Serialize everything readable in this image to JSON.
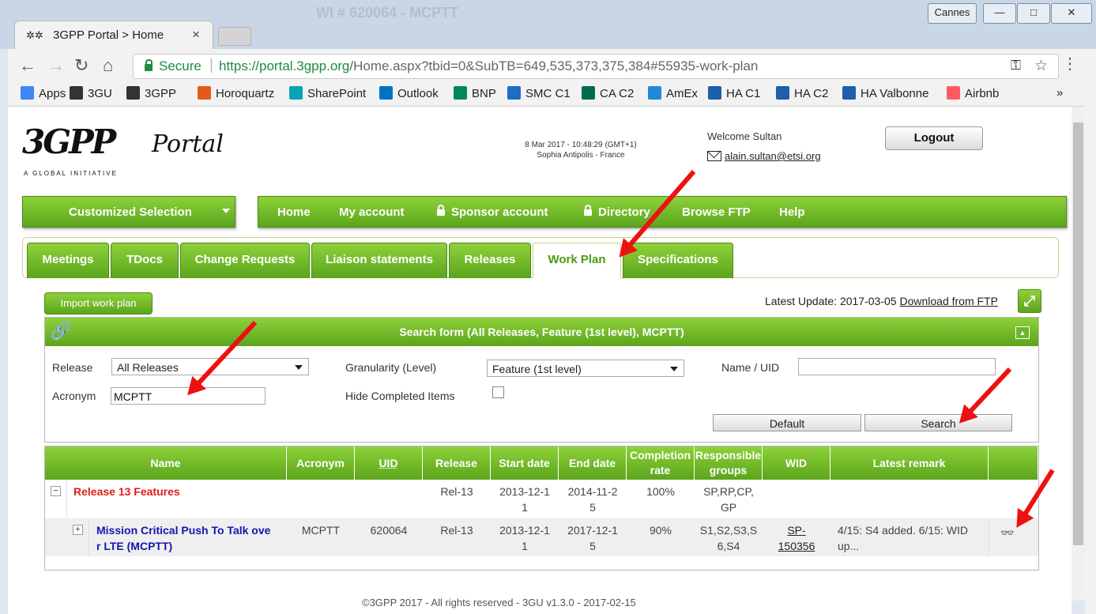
{
  "window": {
    "background_title": "WI # 620064 - MCPTT",
    "cannes_label": "Cannes",
    "minimize": "—",
    "maximize": "□",
    "close": "✕"
  },
  "tab": {
    "title": "3GPP Portal > Home",
    "close": "×"
  },
  "toolbar": {
    "secure_label": "Secure",
    "url_host": "https://portal.3gpp.org",
    "url_path": "/Home.aspx?tbid=0&SubTB=649,535,373,375,384#55935-work-plan"
  },
  "bookmarks": [
    {
      "label": "Apps",
      "icon": "apps-icon",
      "color": "#4285f4"
    },
    {
      "label": "3GU",
      "icon": "3gpp-icon",
      "color": "#333333"
    },
    {
      "label": "3GPP",
      "icon": "3gpp-icon",
      "color": "#333333"
    },
    {
      "label": "Horoquartz",
      "icon": "horoquartz-icon",
      "color": "#e25b1d"
    },
    {
      "label": "SharePoint",
      "icon": "sharepoint-icon",
      "color": "#0aa2b5"
    },
    {
      "label": "Outlook",
      "icon": "outlook-icon",
      "color": "#0072c6"
    },
    {
      "label": "BNP",
      "icon": "bnp-icon",
      "color": "#008856"
    },
    {
      "label": "SMC C1",
      "icon": "star-icon",
      "color": "#1b6ec2"
    },
    {
      "label": "CA C2",
      "icon": "ca-icon",
      "color": "#006a4e"
    },
    {
      "label": "AmEx",
      "icon": "amex-icon",
      "color": "#1e8ad6"
    },
    {
      "label": "HA C1",
      "icon": "ha-icon",
      "color": "#1d5fa8"
    },
    {
      "label": "HA C2",
      "icon": "ha-icon",
      "color": "#1d5fa8"
    },
    {
      "label": "HA Valbonne",
      "icon": "ha-icon",
      "color": "#1d5fa8"
    },
    {
      "label": "Airbnb",
      "icon": "airbnb-icon",
      "color": "#ff5a5f"
    }
  ],
  "header": {
    "logo_text": "3GPP",
    "logo_tagline": "A GLOBAL INITIATIVE",
    "portal_logo": "Portal",
    "datetime_line1": "8 Mar 2017 - 10:48:29 (GMT+1)",
    "datetime_line2": "Sophia Antipolis - France",
    "welcome": "Welcome Sultan",
    "email": "alain.sultan@etsi.org",
    "logout": "Logout"
  },
  "menu": {
    "customized_selection": "Customized Selection",
    "items": [
      "Home",
      "My account",
      "Sponsor account",
      "Directory",
      "Browse FTP",
      "Help"
    ]
  },
  "tabs": [
    "Meetings",
    "TDocs",
    "Change Requests",
    "Liaison statements",
    "Releases",
    "Work Plan",
    "Specifications"
  ],
  "active_tab": "Work Plan",
  "workplan": {
    "import_button": "Import work plan",
    "latest_update_prefix": "Latest Update: 2017-03-05",
    "download_link": "Download from FTP"
  },
  "search_form": {
    "title": "Search form (All Releases, Feature (1st level), MCPTT)",
    "release_label": "Release",
    "release_value": "All Releases",
    "granularity_label": "Granularity (Level)",
    "granularity_value": "Feature (1st level)",
    "name_uid_label": "Name / UID",
    "name_uid_value": "",
    "acronym_label": "Acronym",
    "acronym_value": "MCPTT",
    "hide_completed_label": "Hide Completed Items",
    "default_button": "Default",
    "search_button": "Search"
  },
  "results": {
    "columns": [
      "Name",
      "Acronym",
      "UID",
      "Release",
      "Start date",
      "End date",
      "Completion rate",
      "Responsible groups",
      "WID",
      "Latest remark",
      ""
    ],
    "release_row": {
      "toggle": "−",
      "name": "Release 13 Features",
      "release": "Rel-13",
      "start_date": [
        "2013-12-1",
        "1"
      ],
      "end_date": [
        "2014-11-2",
        "5"
      ],
      "completion": "100%",
      "groups": [
        "SP,RP,CP,",
        "GP"
      ]
    },
    "item_row": {
      "toggle": "+",
      "name": [
        "Mission Critical Push To Talk ove",
        "r LTE (MCPTT)"
      ],
      "acronym": "MCPTT",
      "uid": "620064",
      "release": "Rel-13",
      "start_date": [
        "2013-12-1",
        "1"
      ],
      "end_date": [
        "2017-12-1",
        "5"
      ],
      "completion": "90%",
      "groups": [
        "S1,S2,S3,S",
        "6,S4"
      ],
      "wid": [
        "SP-",
        "150356"
      ],
      "remark": [
        "4/15: S4 added. 6/15: WID",
        "up..."
      ]
    }
  },
  "footer": "©3GPP 2017 - All rights reserved - 3GU v1.3.0 - 2017-02-15",
  "colors": {
    "green": "#6cb62a",
    "release_red": "#e01b1b",
    "link_blue": "#1515b5",
    "arrow_red": "#ee1111"
  }
}
